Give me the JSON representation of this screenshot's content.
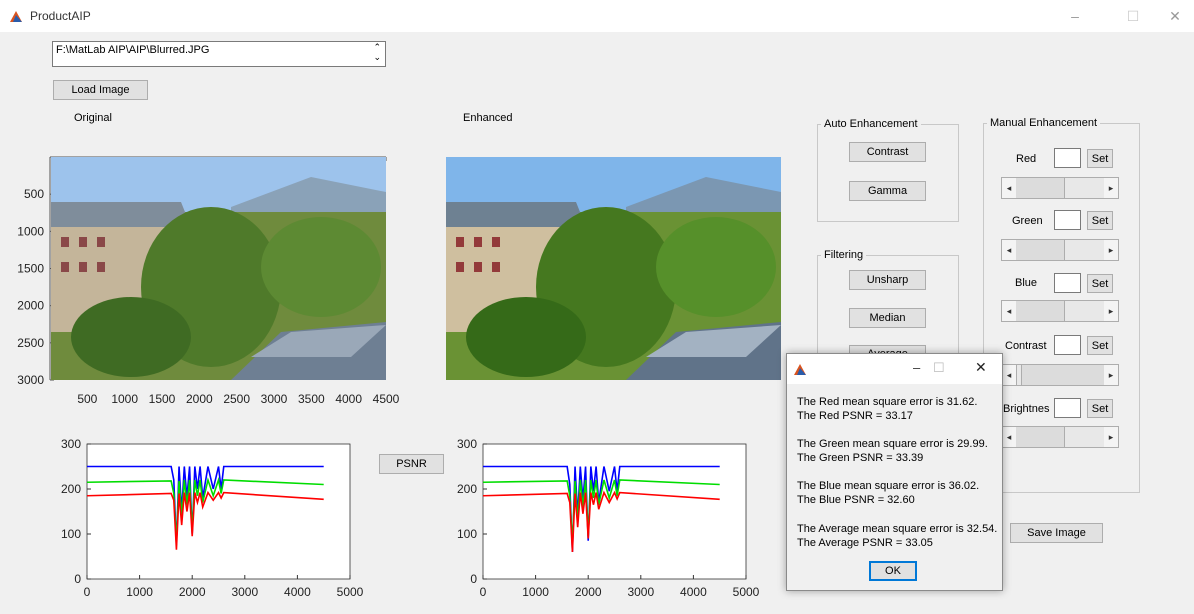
{
  "window": {
    "title": "ProductAIP",
    "controls": [
      "–",
      "☐",
      "✕"
    ]
  },
  "file_path": "F:\\MatLab AIP\\AIP\\Blurred.JPG",
  "buttons": {
    "load": "Load Image",
    "psnr": "PSNR",
    "save": "Save Image"
  },
  "labels": {
    "original": "Original",
    "enhanced": "Enhanced"
  },
  "auto_enhancement": {
    "title": "Auto Enhancement",
    "contrast": "Contrast",
    "gamma": "Gamma"
  },
  "filtering": {
    "title": "Filtering",
    "unsharp": "Unsharp",
    "median": "Median",
    "average": "Average"
  },
  "manual_enhancement": {
    "title": "Manual Enhancement",
    "set_label": "Set",
    "rows": [
      {
        "label": "Red",
        "value": ""
      },
      {
        "label": "Green",
        "value": ""
      },
      {
        "label": "Blue",
        "value": ""
      },
      {
        "label": "Contrast",
        "value": ""
      },
      {
        "label": "Brightnes",
        "value": ""
      }
    ]
  },
  "image_axes": {
    "y_ticks": [
      "500",
      "1000",
      "1500",
      "2000",
      "2500",
      "3000"
    ],
    "x_ticks": [
      "500",
      "1000",
      "1500",
      "2000",
      "2500",
      "3000",
      "3500",
      "4000",
      "4500"
    ]
  },
  "hist_axes": {
    "y_ticks": [
      "0",
      "100",
      "200",
      "300"
    ],
    "x_ticks": [
      "0",
      "1000",
      "2000",
      "3000",
      "4000",
      "5000"
    ]
  },
  "chart_data": [
    {
      "type": "line",
      "title": "",
      "xlim": [
        0,
        5000
      ],
      "ylim": [
        0,
        300
      ],
      "series": [
        {
          "color": "#0000ff",
          "x": [
            0,
            1600,
            1650,
            1700,
            1750,
            1800,
            1850,
            1900,
            1950,
            2000,
            2050,
            2100,
            2150,
            2200,
            2300,
            2400,
            2500,
            2550,
            2600,
            4500
          ],
          "y": [
            250,
            250,
            220,
            75,
            250,
            150,
            250,
            180,
            250,
            100,
            250,
            200,
            250,
            180,
            250,
            200,
            250,
            200,
            250,
            250
          ]
        },
        {
          "color": "#00dd00",
          "x": [
            0,
            1600,
            1650,
            1700,
            1750,
            1800,
            1850,
            1900,
            1950,
            2000,
            2050,
            2100,
            2150,
            2200,
            2300,
            2400,
            2500,
            2550,
            2600,
            4500
          ],
          "y": [
            215,
            218,
            190,
            80,
            218,
            140,
            220,
            165,
            220,
            105,
            220,
            185,
            220,
            170,
            220,
            185,
            220,
            190,
            220,
            210
          ]
        },
        {
          "color": "#ff0000",
          "x": [
            0,
            1600,
            1650,
            1700,
            1750,
            1800,
            1850,
            1900,
            1950,
            2000,
            2050,
            2100,
            2150,
            2200,
            2300,
            2400,
            2500,
            2550,
            2600,
            4500
          ],
          "y": [
            185,
            190,
            175,
            65,
            190,
            120,
            192,
            150,
            192,
            95,
            192,
            170,
            192,
            160,
            192,
            175,
            192,
            180,
            192,
            177
          ]
        }
      ]
    },
    {
      "type": "line",
      "title": "",
      "xlim": [
        0,
        5000
      ],
      "ylim": [
        0,
        300
      ],
      "series": [
        {
          "color": "#0000ff",
          "x": [
            0,
            1600,
            1650,
            1700,
            1750,
            1800,
            1850,
            1900,
            1950,
            2000,
            2050,
            2100,
            2150,
            2200,
            2300,
            2400,
            2500,
            2550,
            2600,
            4500
          ],
          "y": [
            250,
            250,
            210,
            60,
            250,
            140,
            250,
            175,
            250,
            85,
            250,
            195,
            250,
            170,
            250,
            195,
            250,
            195,
            250,
            250
          ]
        },
        {
          "color": "#00dd00",
          "x": [
            0,
            1600,
            1650,
            1700,
            1750,
            1800,
            1850,
            1900,
            1950,
            2000,
            2050,
            2100,
            2150,
            2200,
            2300,
            2400,
            2500,
            2550,
            2600,
            4500
          ],
          "y": [
            215,
            218,
            185,
            75,
            218,
            130,
            220,
            160,
            220,
            95,
            220,
            180,
            220,
            165,
            220,
            180,
            220,
            185,
            220,
            210
          ]
        },
        {
          "color": "#ff0000",
          "x": [
            0,
            1600,
            1650,
            1700,
            1750,
            1800,
            1850,
            1900,
            1950,
            2000,
            2050,
            2100,
            2150,
            2200,
            2300,
            2400,
            2500,
            2550,
            2600,
            4500
          ],
          "y": [
            185,
            190,
            170,
            60,
            190,
            115,
            192,
            145,
            192,
            90,
            192,
            165,
            192,
            155,
            192,
            170,
            192,
            178,
            192,
            177
          ]
        }
      ]
    }
  ],
  "dialog": {
    "controls": [
      "–",
      "☐",
      "✕"
    ],
    "lines": [
      "The Red mean square error is 31.62.",
      "The Red PSNR = 33.17",
      "The Green mean square error is 29.99.",
      "The Green PSNR = 33.39",
      "The Blue mean square error is 36.02.",
      "The Blue PSNR = 32.60",
      "The Average mean square error is 32.54.",
      "The Average PSNR = 33.05"
    ],
    "ok": "OK"
  },
  "colors": {
    "accent": "#0078d7",
    "window_bg": "#f0f0f0"
  }
}
